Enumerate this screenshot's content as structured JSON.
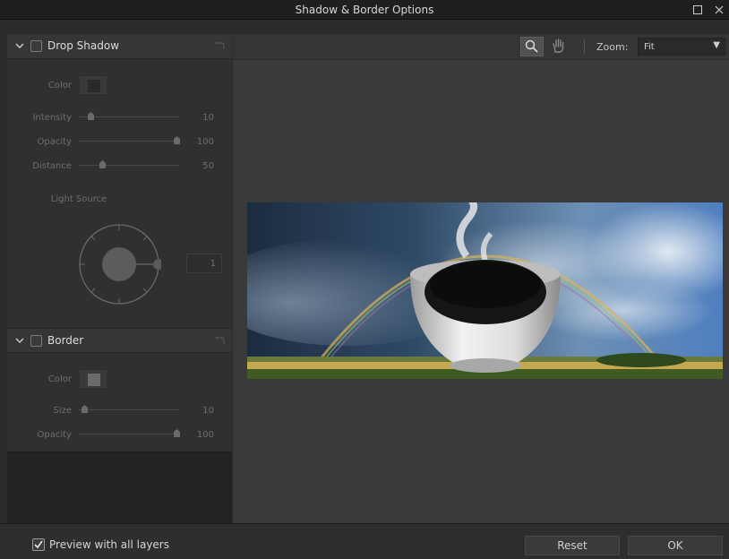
{
  "window": {
    "title": "Shadow & Border Options"
  },
  "drop_shadow": {
    "title": "Drop Shadow",
    "color_label": "Color",
    "intensity_label": "Intensity",
    "intensity_value": "10",
    "opacity_label": "Opacity",
    "opacity_value": "100",
    "distance_label": "Distance",
    "distance_value": "50",
    "light_source_label": "Light Source",
    "light_source_value": "1",
    "swatch_color": "#2a2a2a"
  },
  "border": {
    "title": "Border",
    "color_label": "Color",
    "size_label": "Size",
    "size_value": "10",
    "opacity_label": "Opacity",
    "opacity_value": "100",
    "swatch_color": "#6a6a6a"
  },
  "toolbar": {
    "zoom_label": "Zoom:",
    "zoom_value": "Fit",
    "icons": [
      "zoom-tool-icon",
      "hand-tool-icon"
    ]
  },
  "footer": {
    "preview_label": "Preview with all layers",
    "preview_checked": true,
    "reset_label": "Reset",
    "ok_label": "OK"
  }
}
